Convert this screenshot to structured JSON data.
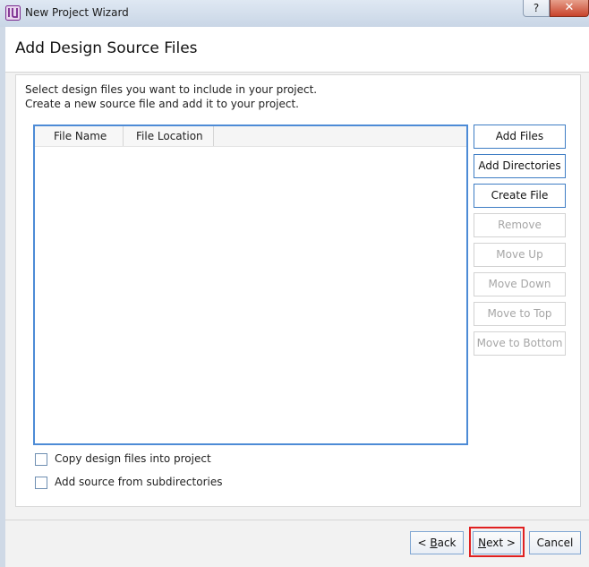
{
  "window": {
    "title": "New Project Wizard",
    "help_label": "?",
    "close_label": "✕"
  },
  "page": {
    "title": "Add Design Source Files",
    "description_line1": "Select design files you want to include in your project.",
    "description_line2": "Create a new source file and add it to your project."
  },
  "table": {
    "columns": [
      "File Name",
      "File Location"
    ],
    "rows": []
  },
  "side_buttons": [
    {
      "label": "Add Files",
      "enabled": true
    },
    {
      "label": "Add Directories",
      "enabled": true
    },
    {
      "label": "Create File",
      "enabled": true
    },
    {
      "label": "Remove",
      "enabled": false
    },
    {
      "label": "Move Up",
      "enabled": false
    },
    {
      "label": "Move Down",
      "enabled": false
    },
    {
      "label": "Move to Top",
      "enabled": false
    },
    {
      "label": "Move to Bottom",
      "enabled": false
    }
  ],
  "options": {
    "copy_files": {
      "label": "Copy design files into project",
      "checked": false
    },
    "subdirs": {
      "label": "Add source from subdirectories",
      "checked": false
    }
  },
  "footer": {
    "back_prefix": "< ",
    "back_mnemonic": "B",
    "back_rest": "ack",
    "next_mnemonic": "N",
    "next_rest": "ext >",
    "cancel_label": "Cancel"
  },
  "colors": {
    "focus_border": "#4d8bd6",
    "highlight": "#e02020"
  },
  "icons": {
    "app": "vivado-app-icon"
  }
}
